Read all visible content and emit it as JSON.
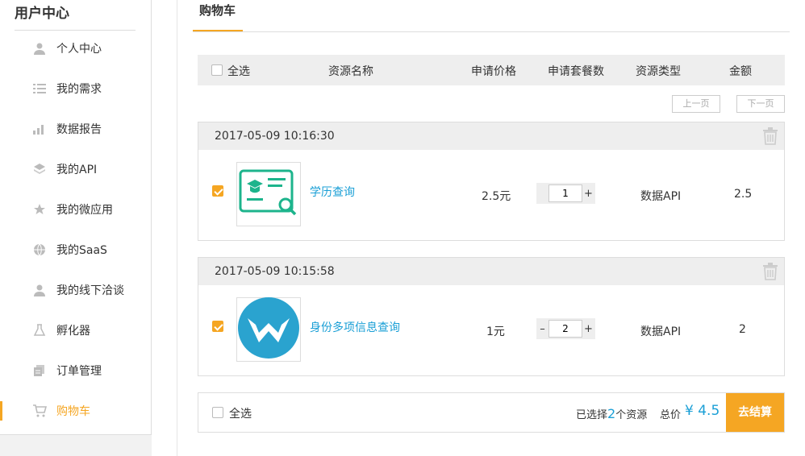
{
  "sidebar": {
    "title": "用户中心",
    "items": [
      {
        "label": "个人中心",
        "icon": "person-icon"
      },
      {
        "label": "我的需求",
        "icon": "list-icon"
      },
      {
        "label": "数据报告",
        "icon": "bar-chart-icon"
      },
      {
        "label": "我的API",
        "icon": "layers-icon"
      },
      {
        "label": "我的微应用",
        "icon": "star-icon"
      },
      {
        "label": "我的SaaS",
        "icon": "globe-icon"
      },
      {
        "label": "我的线下洽谈",
        "icon": "person-icon"
      },
      {
        "label": "孵化器",
        "icon": "flask-icon"
      },
      {
        "label": "订单管理",
        "icon": "documents-icon"
      },
      {
        "label": "购物车",
        "icon": "cart-icon",
        "active": true
      }
    ]
  },
  "tab": {
    "label": "购物车"
  },
  "table_header": {
    "select_all": "全选",
    "name": "资源名称",
    "price": "申请价格",
    "qty": "申请套餐数",
    "type": "资源类型",
    "amount": "金额"
  },
  "pager": {
    "prev": "上一页",
    "next": "下一页"
  },
  "orders": [
    {
      "time": "2017-05-09 10:16:30",
      "name": "学历查询",
      "price": "2.5元",
      "qty": "1",
      "type": "数据API",
      "amount": "2.5",
      "checked": true,
      "thumb_icon": "certificate-search-icon"
    },
    {
      "time": "2017-05-09 10:15:58",
      "name": "身份多项信息查询",
      "price": "1元",
      "qty": "2",
      "type": "数据API",
      "amount": "2",
      "checked": true,
      "thumb_icon": "blue-w-logo-icon"
    }
  ],
  "stepper": {
    "minus": "–",
    "plus": "+"
  },
  "footer": {
    "select_all": "全选",
    "selected_prefix": "已选择",
    "selected_count": "2",
    "selected_suffix": "个资源",
    "total_label": "总价",
    "total_value": "¥ 4.5",
    "checkout": "去结算"
  },
  "colors": {
    "accent": "#f5a623",
    "link": "#1a9fd6",
    "header_bg": "#eeeeee"
  }
}
